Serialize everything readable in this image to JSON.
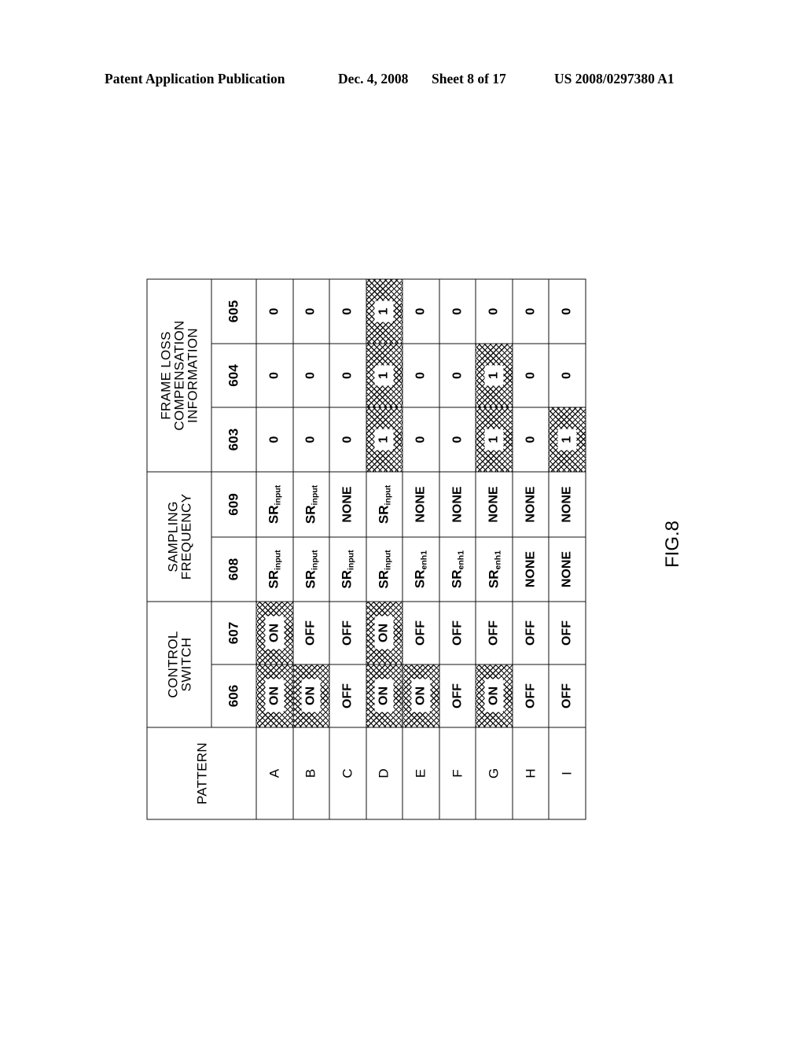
{
  "header": {
    "publication": "Patent Application Publication",
    "date": "Dec. 4, 2008",
    "sheet": "Sheet 8 of 17",
    "patent_number": "US 2008/0297380 A1"
  },
  "figure_label": "FIG.8",
  "table": {
    "groups": {
      "pattern": "PATTERN",
      "control_switch_line1": "CONTROL",
      "control_switch_line2": "SWITCH",
      "sampling_line1": "SAMPLING",
      "sampling_line2": "FREQUENCY",
      "frame_loss_line1": "FRAME LOSS",
      "frame_loss_line2": "COMPENSATION",
      "frame_loss_line3": "INFORMATION"
    },
    "columns": [
      "606",
      "607",
      "608",
      "609",
      "603",
      "604",
      "605"
    ],
    "rows": [
      {
        "pattern": "A",
        "c606": "ON",
        "c607": "ON",
        "c608": "SR",
        "c608_sub": "input",
        "c609": "SR",
        "c609_sub": "input",
        "c603": "0",
        "c604": "0",
        "c605": "0"
      },
      {
        "pattern": "B",
        "c606": "ON",
        "c607": "OFF",
        "c608": "SR",
        "c608_sub": "input",
        "c609": "SR",
        "c609_sub": "input",
        "c603": "0",
        "c604": "0",
        "c605": "0"
      },
      {
        "pattern": "C",
        "c606": "OFF",
        "c607": "OFF",
        "c608": "SR",
        "c608_sub": "input",
        "c609": "NONE",
        "c609_sub": "",
        "c603": "0",
        "c604": "0",
        "c605": "0"
      },
      {
        "pattern": "D",
        "c606": "ON",
        "c607": "ON",
        "c608": "SR",
        "c608_sub": "input",
        "c609": "SR",
        "c609_sub": "input",
        "c603": "1",
        "c604": "1",
        "c605": "1"
      },
      {
        "pattern": "E",
        "c606": "ON",
        "c607": "OFF",
        "c608": "SR",
        "c608_sub": "enh1",
        "c609": "NONE",
        "c609_sub": "",
        "c603": "0",
        "c604": "0",
        "c605": "0"
      },
      {
        "pattern": "F",
        "c606": "OFF",
        "c607": "OFF",
        "c608": "SR",
        "c608_sub": "enh1",
        "c609": "NONE",
        "c609_sub": "",
        "c603": "0",
        "c604": "0",
        "c605": "0"
      },
      {
        "pattern": "G",
        "c606": "ON",
        "c607": "OFF",
        "c608": "SR",
        "c608_sub": "enh1",
        "c609": "NONE",
        "c609_sub": "",
        "c603": "1",
        "c604": "1",
        "c605": "0"
      },
      {
        "pattern": "H",
        "c606": "OFF",
        "c607": "OFF",
        "c608": "NONE",
        "c608_sub": "",
        "c609": "NONE",
        "c609_sub": "",
        "c603": "0",
        "c604": "0",
        "c605": "0"
      },
      {
        "pattern": "I",
        "c606": "OFF",
        "c607": "OFF",
        "c608": "NONE",
        "c608_sub": "",
        "c609": "NONE",
        "c609_sub": "",
        "c603": "1",
        "c604": "0",
        "c605": "0"
      }
    ]
  }
}
